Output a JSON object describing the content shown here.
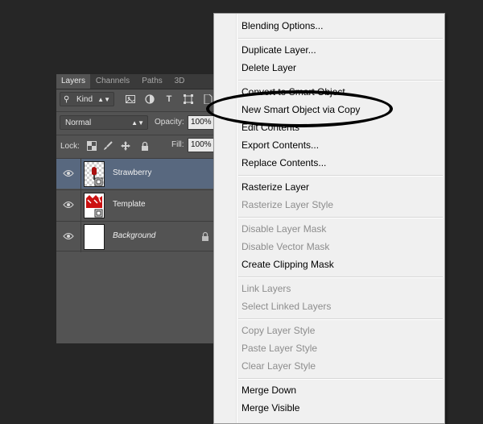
{
  "layers_panel": {
    "tabs": [
      {
        "label": "Layers",
        "active": true
      },
      {
        "label": "Channels",
        "active": false
      },
      {
        "label": "Paths",
        "active": false
      },
      {
        "label": "3D",
        "active": false
      }
    ],
    "filter": {
      "kind_label": "Kind",
      "icons": [
        "image-filter-icon",
        "adjustment-filter-icon",
        "type-filter-icon",
        "shape-filter-icon",
        "smart-object-filter-icon"
      ]
    },
    "blend_mode": "Normal",
    "opacity_label": "Opacity:",
    "opacity_value": "100%",
    "lock_label": "Lock:",
    "fill_label": "Fill:",
    "fill_value": "100%",
    "layers": [
      {
        "name": "Strawberry",
        "selected": true,
        "italic": false,
        "locked": false
      },
      {
        "name": "Template",
        "selected": false,
        "italic": false,
        "locked": false
      },
      {
        "name": "Background",
        "selected": false,
        "italic": true,
        "locked": true
      }
    ]
  },
  "context_menu": {
    "items": [
      {
        "label": "Blending Options...",
        "enabled": true
      },
      {
        "label": "Duplicate Layer...",
        "enabled": true
      },
      {
        "label": "Delete Layer",
        "enabled": true
      },
      {
        "label": "Convert to Smart Object",
        "enabled": true
      },
      {
        "label": "New Smart Object via Copy",
        "enabled": true
      },
      {
        "label": "Edit Contents",
        "enabled": true
      },
      {
        "label": "Export Contents...",
        "enabled": true
      },
      {
        "label": "Replace Contents...",
        "enabled": true
      },
      {
        "label": "Rasterize Layer",
        "enabled": true
      },
      {
        "label": "Rasterize Layer Style",
        "enabled": false
      },
      {
        "label": "Disable Layer Mask",
        "enabled": false
      },
      {
        "label": "Disable Vector Mask",
        "enabled": false
      },
      {
        "label": "Create Clipping Mask",
        "enabled": true
      },
      {
        "label": "Link Layers",
        "enabled": false
      },
      {
        "label": "Select Linked Layers",
        "enabled": false
      },
      {
        "label": "Copy Layer Style",
        "enabled": false
      },
      {
        "label": "Paste Layer Style",
        "enabled": false
      },
      {
        "label": "Clear Layer Style",
        "enabled": false
      },
      {
        "label": "Merge Down",
        "enabled": true
      },
      {
        "label": "Merge Visible",
        "enabled": true
      }
    ],
    "highlighted_item": "New Smart Object via Copy"
  },
  "colors": {
    "background": "#262626",
    "panel": "#535353",
    "selected_layer": "#58687f",
    "menu": "#f0f0f0",
    "disabled_text": "#8d8d8d",
    "strawberry_red": "#cc1111"
  }
}
